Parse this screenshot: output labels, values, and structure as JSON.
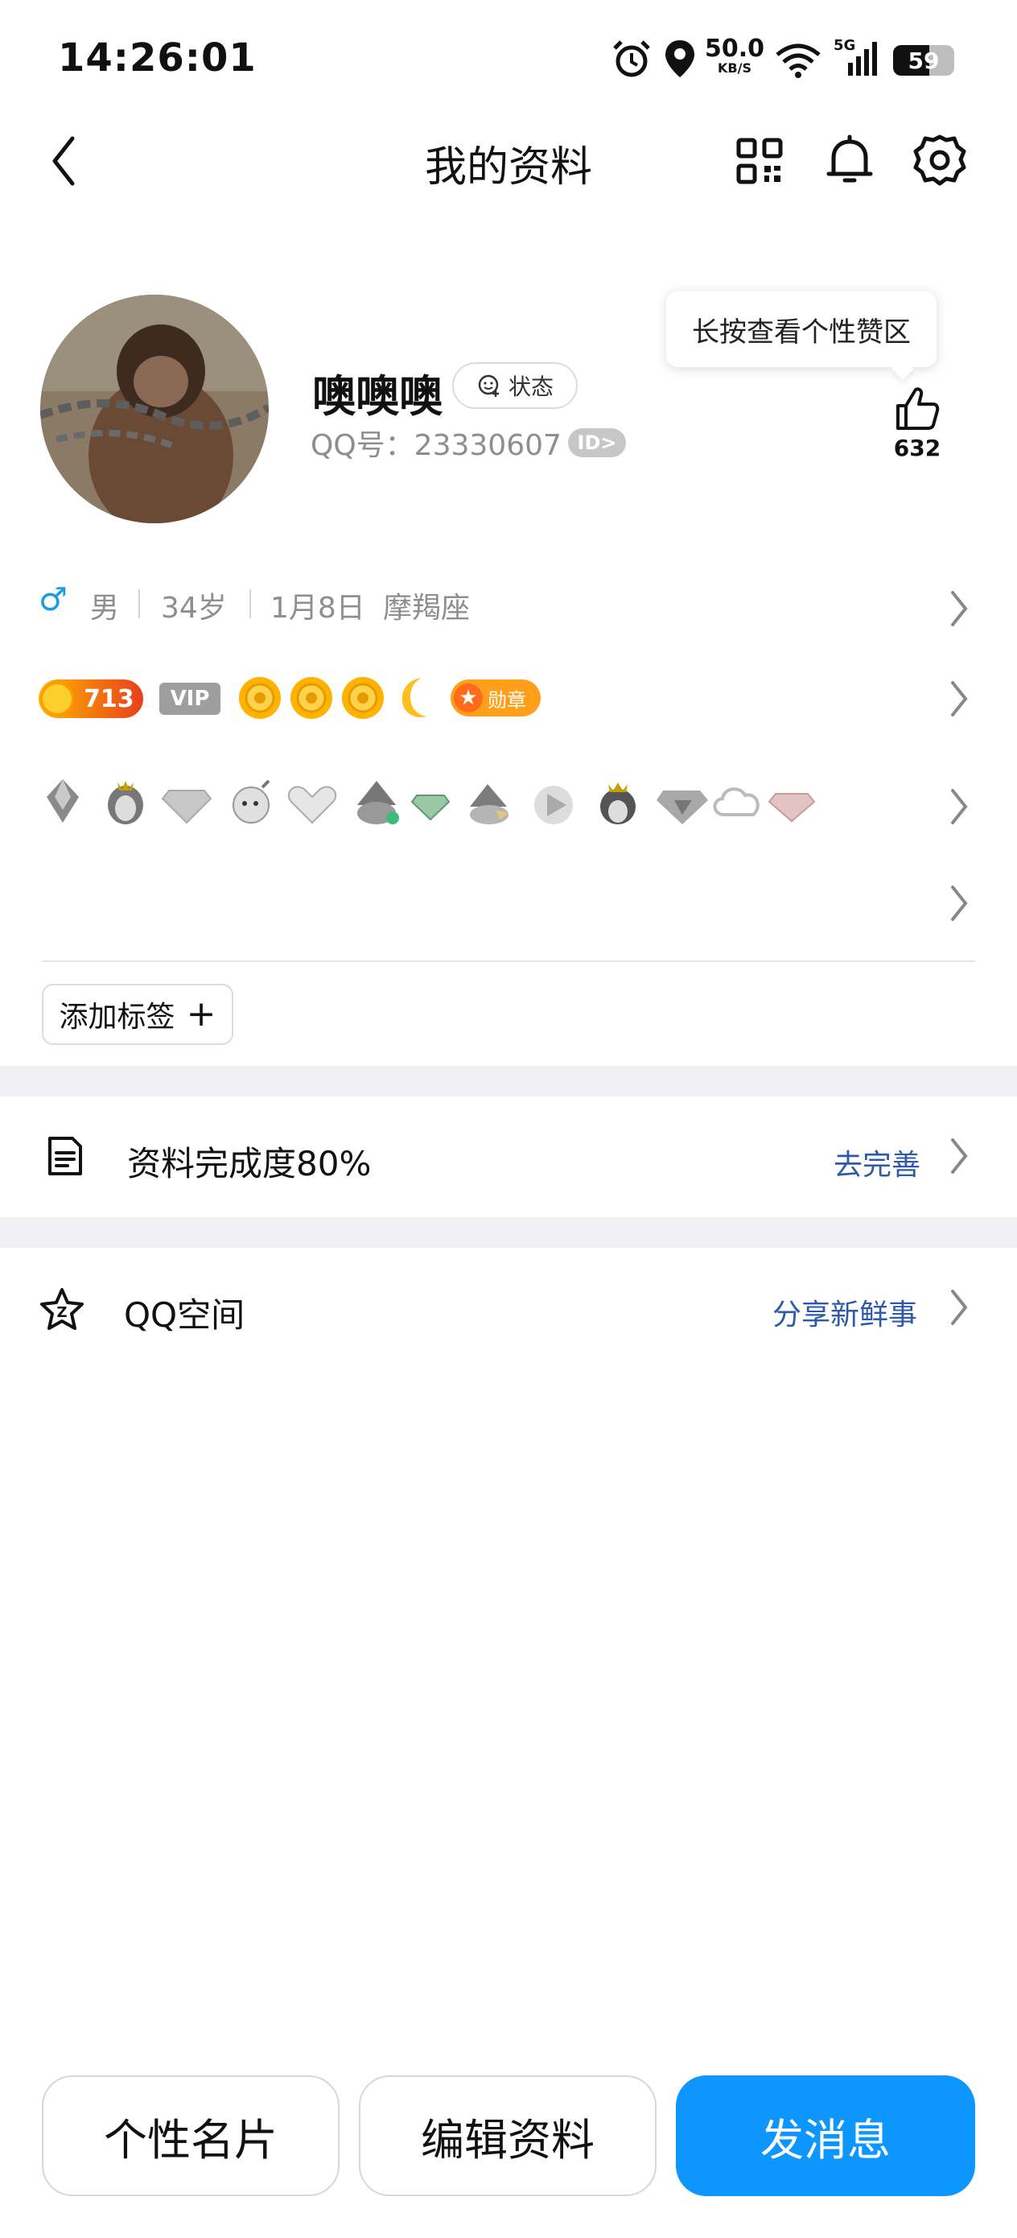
{
  "status_bar": {
    "time": "14:26:01",
    "network_speed": "50.0",
    "network_unit": "KB/S",
    "signal": "5G",
    "battery": "59",
    "icons": [
      "alarm-icon",
      "location-icon",
      "wifi-icon",
      "signal-icon",
      "battery-icon"
    ]
  },
  "header": {
    "title": "我的资料",
    "icons": [
      "back-icon",
      "qr-code-icon",
      "bell-icon",
      "gear-icon"
    ]
  },
  "profile": {
    "nickname": "噢噢噢",
    "status_label": "状态",
    "qq_label": "QQ号：23330607",
    "id_badge": "ID>",
    "tooltip": "长按查看个性赞区",
    "likes": "632"
  },
  "info": {
    "gender_symbol": "♂",
    "gender": "男",
    "age": "34岁",
    "birthday": "1月8日",
    "zodiac": "摩羯座"
  },
  "badges": {
    "level": "713",
    "vip": "VIP",
    "medal": "勋章"
  },
  "tags": {
    "add_label": "添加标签",
    "add_symbol": "+"
  },
  "completeness": {
    "label": "资料完成度80%",
    "action": "去完善"
  },
  "qzone": {
    "label": "QQ空间",
    "action": "分享新鲜事"
  },
  "buttons": {
    "card": "个性名片",
    "edit": "编辑资料",
    "message": "发消息"
  },
  "colors": {
    "primary": "#0e96ff",
    "link": "#2d5aa8",
    "muted": "#8e8e8e",
    "gender": "#1a9be6"
  }
}
